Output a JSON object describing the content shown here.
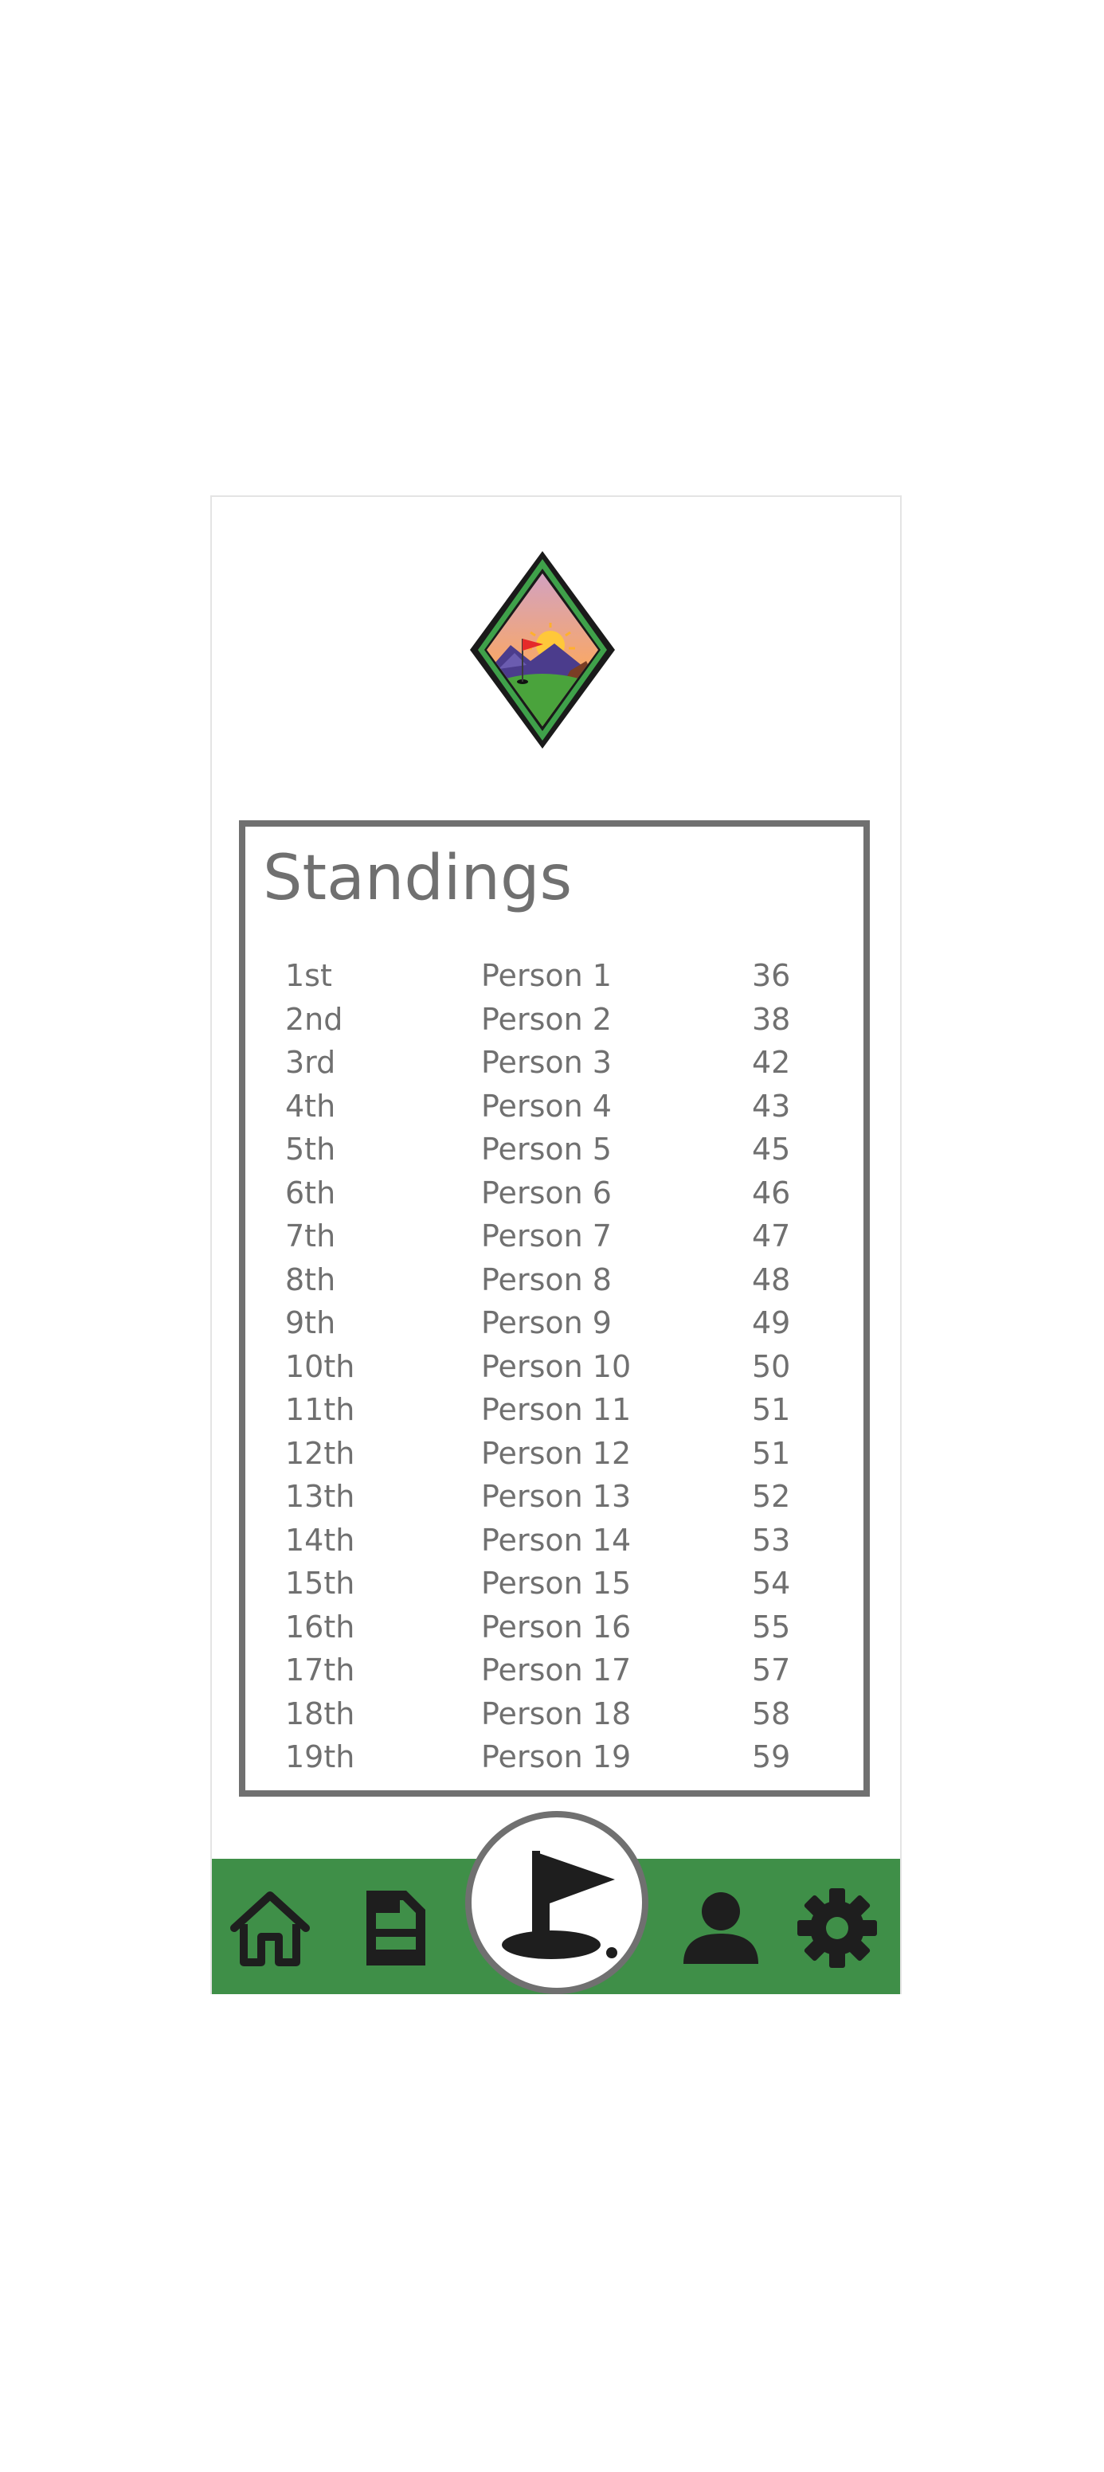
{
  "standings": {
    "title": "Standings",
    "rows": [
      {
        "rank": "1st",
        "name": "Person 1",
        "score": "36"
      },
      {
        "rank": "2nd",
        "name": "Person 2",
        "score": "38"
      },
      {
        "rank": "3rd",
        "name": "Person 3",
        "score": "42"
      },
      {
        "rank": "4th",
        "name": "Person 4",
        "score": "43"
      },
      {
        "rank": "5th",
        "name": "Person 5",
        "score": "45"
      },
      {
        "rank": "6th",
        "name": "Person 6",
        "score": "46"
      },
      {
        "rank": "7th",
        "name": "Person 7",
        "score": "47"
      },
      {
        "rank": "8th",
        "name": "Person 8",
        "score": "48"
      },
      {
        "rank": "9th",
        "name": "Person 9",
        "score": "49"
      },
      {
        "rank": "10th",
        "name": "Person 10",
        "score": "50"
      },
      {
        "rank": "11th",
        "name": "Person 11",
        "score": "51"
      },
      {
        "rank": "12th",
        "name": "Person 12",
        "score": "51"
      },
      {
        "rank": "13th",
        "name": "Person 13",
        "score": "52"
      },
      {
        "rank": "14th",
        "name": "Person 14",
        "score": "53"
      },
      {
        "rank": "15th",
        "name": "Person 15",
        "score": "54"
      },
      {
        "rank": "16th",
        "name": "Person 16",
        "score": "55"
      },
      {
        "rank": "17th",
        "name": "Person 17",
        "score": "57"
      },
      {
        "rank": "18th",
        "name": "Person 18",
        "score": "58"
      },
      {
        "rank": "19th",
        "name": "Person 19",
        "score": "59"
      }
    ]
  },
  "nav": {
    "items": [
      {
        "icon": "home-icon"
      },
      {
        "icon": "document-icon"
      },
      {
        "icon": "golf-flag-icon"
      },
      {
        "icon": "person-icon"
      },
      {
        "icon": "gear-icon"
      }
    ]
  },
  "colors": {
    "nav_green": "#3f8f48",
    "text_gray": "#707070",
    "border_gray": "#707070",
    "icon_dark": "#1e1e1e"
  }
}
